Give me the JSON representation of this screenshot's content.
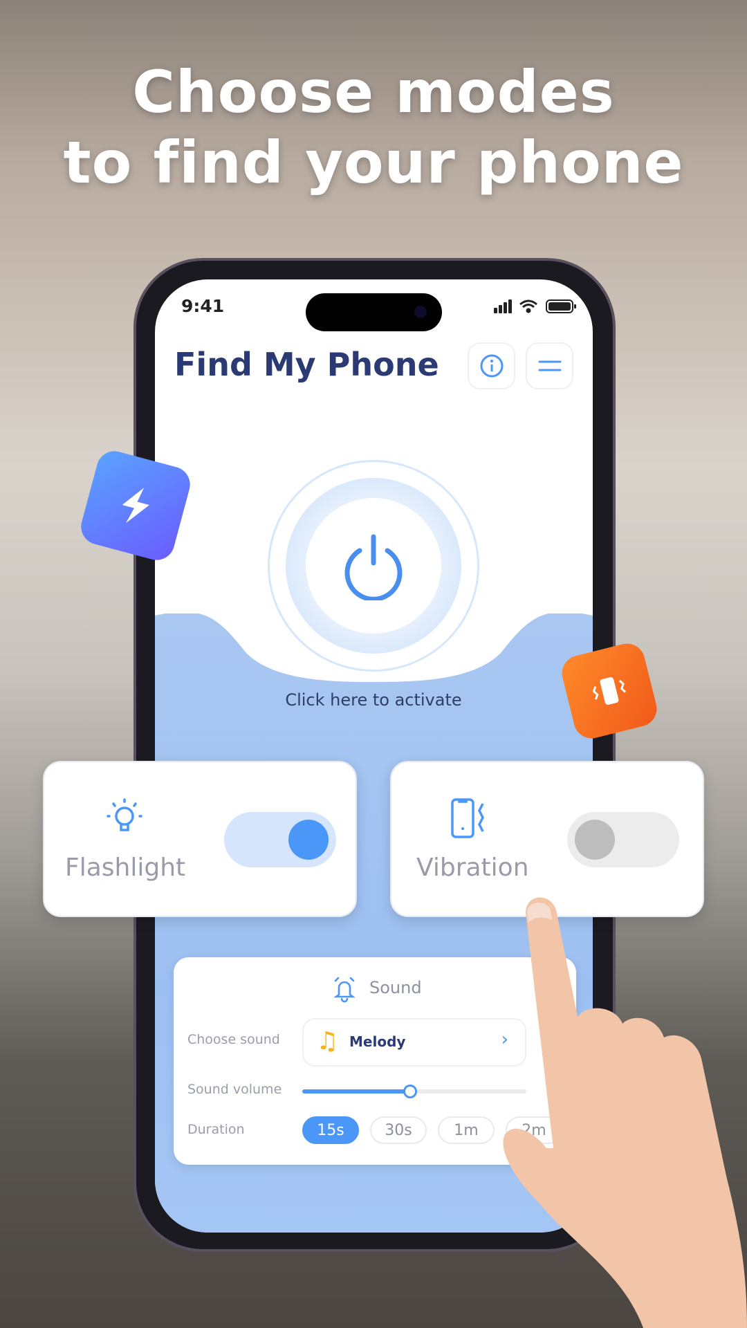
{
  "headline": {
    "line1": "Choose modes",
    "line2": "to find your phone"
  },
  "status_bar": {
    "time": "9:41"
  },
  "app": {
    "title": "Find My Phone",
    "info_icon": "info-icon",
    "menu_icon": "menu-icon"
  },
  "power": {
    "icon": "power-icon",
    "caption": "Click here to activate"
  },
  "modes": [
    {
      "label": "Flashlight",
      "icon": "lightbulb-icon",
      "on": true
    },
    {
      "label": "Vibration",
      "icon": "phone-vibrate-icon",
      "on": false
    }
  ],
  "sound": {
    "title": "Sound",
    "choose_label": "Choose sound",
    "selected": "Melody",
    "volume_label": "Sound volume",
    "volume_percent": 48,
    "duration_label": "Duration",
    "durations": [
      "15s",
      "30s",
      "1m",
      "2m"
    ],
    "selected_duration": "15s"
  },
  "colors": {
    "accent": "#4a97f7",
    "title": "#2b3a72",
    "orange": "#f5701f",
    "purple": "#6a5cff"
  }
}
